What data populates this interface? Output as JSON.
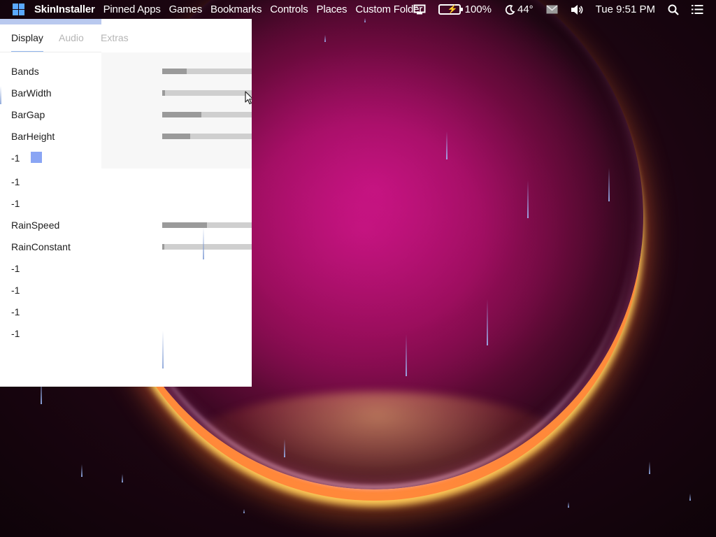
{
  "menubar": {
    "app_name": "SkinInstaller",
    "menus": [
      "Pinned Apps",
      "Games",
      "Bookmarks",
      "Controls",
      "Places",
      "Custom Folder"
    ],
    "battery": "100%",
    "weather": "44°",
    "clock": "Tue 9:51 PM"
  },
  "panel": {
    "tabs": [
      "Display",
      "Audio",
      "Extras"
    ],
    "active_tab": "Display",
    "rows": [
      {
        "label": "Bands",
        "slider": 0.27
      },
      {
        "label": "BarWidth",
        "slider": 0.03
      },
      {
        "label": "BarGap",
        "slider": 0.44
      },
      {
        "label": "BarHeight",
        "slider": 0.31
      },
      {
        "label": "-1",
        "swatch_color": "#8aa5f4"
      },
      {
        "label": "-1"
      },
      {
        "label": "-1"
      },
      {
        "label": "RainSpeed",
        "slider": 0.5
      },
      {
        "label": "RainConstant",
        "slider": 0.02
      },
      {
        "label": "-1"
      },
      {
        "label": "-1"
      },
      {
        "label": "-1"
      },
      {
        "label": "-1"
      }
    ]
  },
  "colors": {
    "accent": "#8fb3ec",
    "windows_logo": "#5aa9ff",
    "battery_fill": "#6bd64a",
    "swatch": "#8aa5f4"
  }
}
